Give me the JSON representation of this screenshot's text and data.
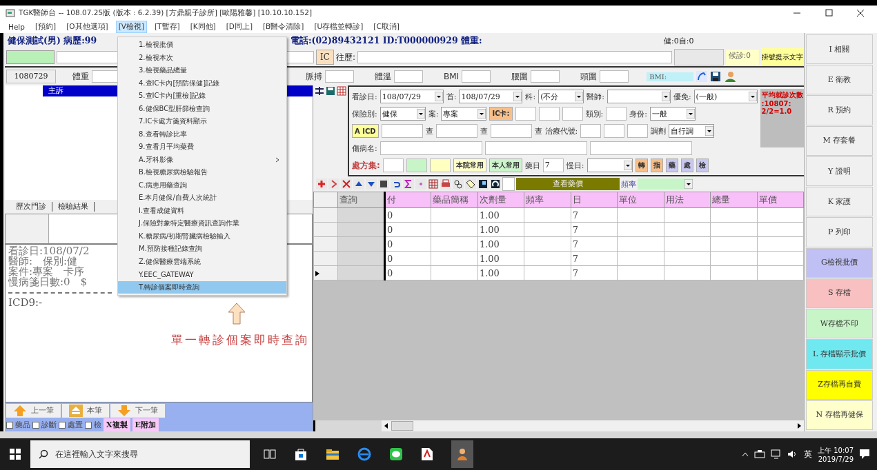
{
  "window": {
    "title": "TGK醫師台 -- 108.07.25版 (版本 : 6.2.39) [方鼎親子診所] [歐陽雅馨] [10.10.10.152]"
  },
  "menu_bar": [
    {
      "label": "Help",
      "selected": false
    },
    {
      "label": "[預約]",
      "selected": false
    },
    {
      "label": "[O其他選項]",
      "selected": false
    },
    {
      "label": "[V檢視]",
      "selected": true
    },
    {
      "label": "[T暫存]",
      "selected": false
    },
    {
      "label": "[K同他]",
      "selected": false
    },
    {
      "label": "[D同上]",
      "selected": false
    },
    {
      "label": "[B醫令清除]",
      "selected": false
    },
    {
      "label": "[U存檔並轉診]",
      "selected": false
    },
    {
      "label": "[C取消]",
      "selected": false
    }
  ],
  "dropdown_menu": [
    {
      "label": "1.檢視批價",
      "selected": false,
      "submenu": false
    },
    {
      "label": "2.檢視本次",
      "selected": false,
      "submenu": false
    },
    {
      "label": "3.檢視藥品總量",
      "selected": false,
      "submenu": false
    },
    {
      "label": "4.查IC卡內[預防保健]記錄",
      "selected": false,
      "submenu": false
    },
    {
      "label": "5.查IC卡內[重檢]記錄",
      "selected": false,
      "submenu": false
    },
    {
      "label": "6.健保BC型肝篩檢查詢",
      "selected": false,
      "submenu": false
    },
    {
      "label": "7.IC卡處方箋資料顯示",
      "selected": false,
      "submenu": false
    },
    {
      "label": "8.查看轉診比率",
      "selected": false,
      "submenu": false
    },
    {
      "label": "9.查看月平均藥費",
      "selected": false,
      "submenu": false
    },
    {
      "label": "A.牙科影像",
      "selected": false,
      "submenu": true
    },
    {
      "label": "B.檢視糖尿病檢驗報告",
      "selected": false,
      "submenu": false
    },
    {
      "label": "C.病患用藥查詢",
      "selected": false,
      "submenu": false
    },
    {
      "label": "E.本月健保/自費人次統計",
      "selected": false,
      "submenu": false
    },
    {
      "label": "I.查看成健資料",
      "selected": false,
      "submenu": false
    },
    {
      "label": "J.保險對象特定醫療資訊查詢作業",
      "selected": false,
      "submenu": false
    },
    {
      "label": "K.糖尿病/初期腎臟病檢驗輸入",
      "selected": false,
      "submenu": false
    },
    {
      "label": "M.預防接種記錄查詢",
      "selected": false,
      "submenu": false
    },
    {
      "label": "Z.健保醫療雲端系統",
      "selected": false,
      "submenu": false
    },
    {
      "label": "Y.EEC_GATEWAY",
      "selected": false,
      "submenu": false
    },
    {
      "label": "T.轉診個案即時查詢",
      "selected": true,
      "submenu": false
    }
  ],
  "patient_header": {
    "name": "健保測試(男) 病歷:99",
    "contact": "電話:(02)89432121 ID:T000000929 體重:",
    "counts": "健:0自:0",
    "ic_button": "IC",
    "history_label": "往歷:",
    "waiting": "候診:0",
    "hint_button": "掛號提示文字"
  },
  "vitals": {
    "date_tab": "1080729",
    "weight_label": "體重",
    "labels": [
      "脈搏",
      "體溫",
      "BMI",
      "腰圍",
      "頭圍"
    ],
    "bmi_label": "BMI:"
  },
  "complaint_header": "主訴",
  "history_tabs": [
    "歷次門診",
    "檢驗結果"
  ],
  "history_text": {
    "lines": [
      "看診日:108/07/2",
      "醫師:　保別:健",
      "案件:專案　卡序",
      "慢病箋日數:0　$"
    ],
    "icd_line": "ICD9:-"
  },
  "nav_buttons": [
    {
      "label": "上一筆",
      "kind": "up"
    },
    {
      "label": "本筆",
      "kind": "current"
    },
    {
      "label": "下一筆",
      "kind": "down"
    }
  ],
  "copy_options": [
    {
      "label": "藥品",
      "checked": false
    },
    {
      "label": "診斷",
      "checked": false
    },
    {
      "label": "處置",
      "checked": false
    },
    {
      "label": "檢",
      "checked": false
    }
  ],
  "copy_buttons": [
    "X複製",
    "E附加"
  ],
  "form_rows": [
    [
      {
        "kind": "label",
        "text": "看診日:"
      },
      {
        "kind": "select",
        "value": "108/07/29"
      },
      {
        "kind": "label",
        "text": "首:"
      },
      {
        "kind": "select",
        "value": "108/07/29"
      },
      {
        "kind": "label",
        "text": "科:"
      },
      {
        "kind": "select_s",
        "value": "(不分"
      },
      {
        "kind": "label",
        "text": "醫師:"
      },
      {
        "kind": "select"
      },
      {
        "kind": "label",
        "text": "優免:"
      },
      {
        "kind": "select",
        "value": "(一般)"
      }
    ],
    [
      {
        "kind": "label",
        "text": "保險別:"
      },
      {
        "kind": "select_s",
        "value": "健保"
      },
      {
        "kind": "label",
        "text": "案:"
      },
      {
        "kind": "select_s",
        "value": "專案"
      },
      {
        "kind": "button",
        "text": "IC卡:",
        "color": "#f7c08a"
      },
      {
        "kind": "input_s"
      },
      {
        "kind": "input_s"
      },
      {
        "kind": "input_s"
      },
      {
        "kind": "label",
        "text": "類別:"
      },
      {
        "kind": "input_s"
      },
      {
        "kind": "label",
        "text": "身份:"
      },
      {
        "kind": "select_s",
        "value": "一般"
      }
    ],
    [
      {
        "kind": "button",
        "text": "A ICD",
        "color": "#ffff99"
      },
      {
        "kind": "input"
      },
      {
        "kind": "label",
        "text": "查"
      },
      {
        "kind": "input"
      },
      {
        "kind": "label",
        "text": "查"
      },
      {
        "kind": "input"
      },
      {
        "kind": "label",
        "text": "查"
      },
      {
        "kind": "label",
        "text": "治療代號:"
      },
      {
        "kind": "input_s"
      },
      {
        "kind": "input_s"
      },
      {
        "kind": "input_s"
      },
      {
        "kind": "label",
        "text": "調劑"
      },
      {
        "kind": "select_s",
        "value": "自行調"
      }
    ],
    [
      {
        "kind": "label",
        "text": "傷病名:"
      },
      {
        "kind": "input_w"
      },
      {
        "kind": "input_w"
      },
      {
        "kind": "input_w"
      }
    ],
    [
      {
        "kind": "label",
        "text": "處方集:",
        "color": "#c04040"
      },
      {
        "kind": "input_s"
      },
      {
        "kind": "input_s",
        "color": "#c8f5c8"
      },
      {
        "kind": "input_s",
        "color": "#ffffc0"
      },
      {
        "kind": "button",
        "text": "本院常用",
        "color": "#ffffcc"
      },
      {
        "kind": "button",
        "text": "本人常用",
        "color": "#ccf5cc"
      },
      {
        "kind": "label",
        "text": "藥日"
      },
      {
        "kind": "input_s",
        "value": "7"
      },
      {
        "kind": "label",
        "text": "慢日:"
      },
      {
        "kind": "select_s"
      },
      {
        "kind": "button",
        "text": "轉",
        "color": "#f7c08a"
      },
      {
        "kind": "button",
        "text": "指",
        "color": "#f7c08a"
      },
      {
        "kind": "button",
        "text": "藥",
        "color": "#c8c8f0"
      },
      {
        "kind": "button",
        "text": "處",
        "color": "#c8c8f0"
      },
      {
        "kind": "button",
        "text": "檢",
        "color": "#c8c8f0"
      }
    ]
  ],
  "avg_visits": {
    "title": "平均就診次數",
    "value": ":10807: 2/2=1.0"
  },
  "toolbar": {
    "price_button": "查看藥價",
    "freq_label": "頻率"
  },
  "table": {
    "columns": [
      "查詢",
      "付",
      "藥品簡稱",
      "次劑量",
      "頻率",
      "日",
      "單位",
      "用法",
      "總量",
      "單價"
    ],
    "rows": [
      {
        "current": false,
        "pay": "0",
        "dose": "1.00",
        "days": "7"
      },
      {
        "current": false,
        "pay": "0",
        "dose": "1.00",
        "days": "7"
      },
      {
        "current": false,
        "pay": "0",
        "dose": "1.00",
        "days": "7"
      },
      {
        "current": false,
        "pay": "0",
        "dose": "1.00",
        "days": "7"
      },
      {
        "current": true,
        "pay": "0",
        "dose": "1.00",
        "days": "7"
      }
    ]
  },
  "side_buttons": [
    {
      "label": "I 相關",
      "color": "#f0f0f0"
    },
    {
      "label": "E 衛教",
      "color": "#f0f0f0"
    },
    {
      "label": "R 預約",
      "color": "#f0f0f0"
    },
    {
      "label": "M 存套餐",
      "color": "#f0f0f0"
    },
    {
      "label": "Y 證明",
      "color": "#f0f0f0"
    },
    {
      "label": "K 家護",
      "color": "#f0f0f0"
    },
    {
      "label": "P 列印",
      "color": "#f0f0f0"
    },
    {
      "label": "G檢視批價",
      "color": "#c0c0f5"
    },
    {
      "label": "S 存檔",
      "color": "#f8c0c0"
    },
    {
      "label": "W存檔不印",
      "color": "#c8f5c8"
    },
    {
      "label": "L 存檔顯示批價",
      "color": "#70e8f0"
    },
    {
      "label": "Z存檔再自費",
      "color": "#ffff00"
    },
    {
      "label": "N 存檔再健保",
      "color": "#ffffcc"
    }
  ],
  "annotation": {
    "text": "單一轉診個案即時查詢"
  },
  "taskbar": {
    "search_placeholder": "在這裡輸入文字來搜尋",
    "ime": "英",
    "time": "上午 10:07",
    "date": "2019/7/29"
  }
}
